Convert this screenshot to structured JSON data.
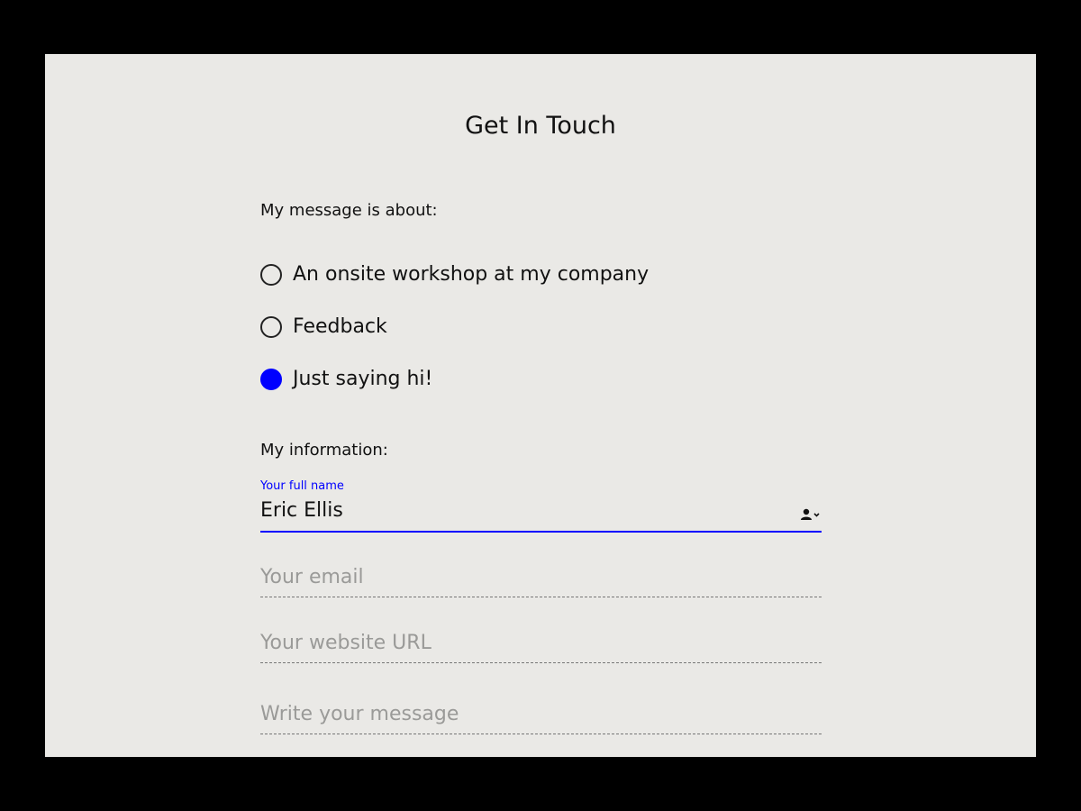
{
  "page": {
    "title": "Get In Touch"
  },
  "topic": {
    "label": "My message is about:",
    "options": [
      {
        "label": "An onsite workshop at my company",
        "checked": false
      },
      {
        "label": "Feedback",
        "checked": false
      },
      {
        "label": "Just saying hi!",
        "checked": true
      }
    ]
  },
  "info": {
    "label": "My information:",
    "name": {
      "label": "Your full name",
      "value": "Eric Ellis",
      "icon": "contact-autofill-icon"
    },
    "email": {
      "placeholder": "Your email",
      "value": ""
    },
    "website": {
      "placeholder": "Your website URL",
      "value": ""
    },
    "message": {
      "placeholder": "Write your message",
      "value": ""
    }
  },
  "colors": {
    "accent": "#0000ff",
    "panel_bg": "#eae9e6",
    "backdrop": "#000000",
    "placeholder": "#9a9a98"
  }
}
